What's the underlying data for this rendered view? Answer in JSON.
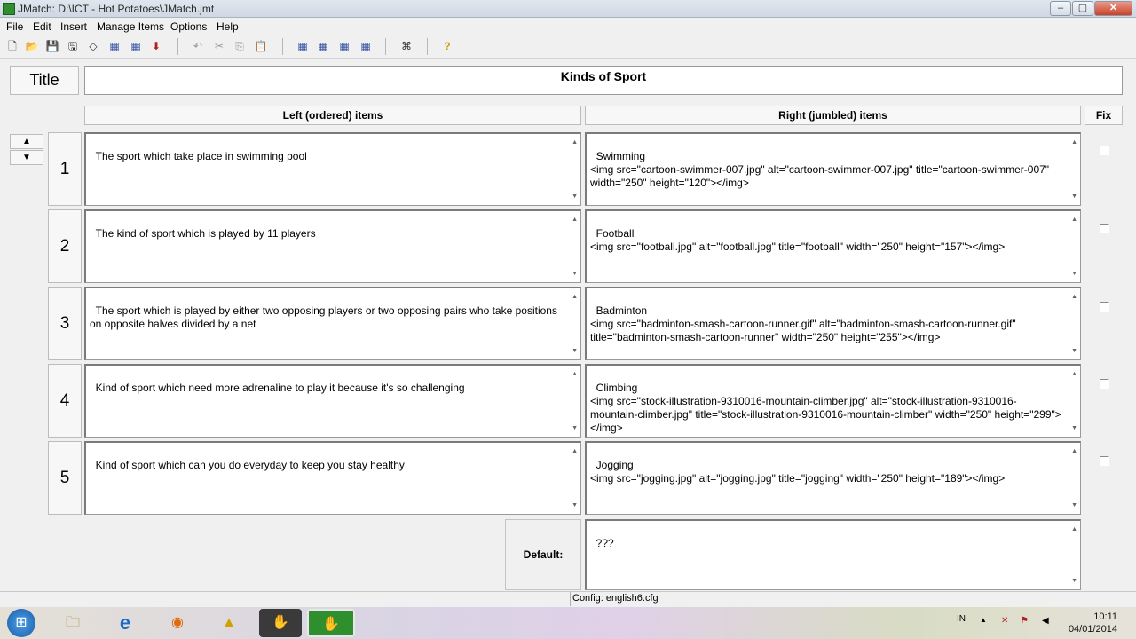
{
  "window": {
    "title": "JMatch: D:\\ICT - Hot Potatoes\\JMatch.jmt",
    "min": "‒",
    "max": "▢",
    "close": "✕"
  },
  "menu": [
    "File",
    "Edit",
    "Insert",
    "Manage Items",
    "Options",
    "Help"
  ],
  "toolbar": {
    "new": "🗋",
    "open": "📂",
    "save": "💾",
    "save_as": "🖫",
    "clear": "◇",
    "web1": "▦",
    "web2": "▦",
    "export": "⬇",
    "undo": "↶",
    "cut": "✂",
    "copy": "⎘",
    "paste": "📋",
    "config1": "▦",
    "config2": "▦",
    "config3": "▦",
    "config4": "▦",
    "dict": "⌘",
    "help": "?"
  },
  "title_label": "Title",
  "title_value": "Kinds of Sport",
  "headers": {
    "left": "Left (ordered) items",
    "right": "Right (jumbled) items",
    "fix": "Fix"
  },
  "arrows": {
    "up": "▲",
    "down": "▼"
  },
  "rows": [
    {
      "num": "1",
      "left": "The sport which take place in swimming pool",
      "right": "Swimming\n<img src=\"cartoon-swimmer-007.jpg\" alt=\"cartoon-swimmer-007.jpg\" title=\"cartoon-swimmer-007\" width=\"250\" height=\"120\"></img>"
    },
    {
      "num": "2",
      "left": "The kind of sport which is played by 11 players",
      "right": "Football\n<img src=\"football.jpg\" alt=\"football.jpg\" title=\"football\" width=\"250\" height=\"157\"></img>"
    },
    {
      "num": "3",
      "left": "The sport which is played by either two opposing players or two opposing pairs who take positions on opposite halves divided by a net",
      "right": "Badminton\n<img src=\"badminton-smash-cartoon-runner.gif\" alt=\"badminton-smash-cartoon-runner.gif\" title=\"badminton-smash-cartoon-runner\" width=\"250\" height=\"255\"></img>"
    },
    {
      "num": "4",
      "left": "Kind of sport which need more adrenaline to play it because it's so challenging",
      "right": "Climbing\n<img src=\"stock-illustration-9310016-mountain-climber.jpg\" alt=\"stock-illustration-9310016-mountain-climber.jpg\" title=\"stock-illustration-9310016-mountain-climber\" width=\"250\" height=\"299\"></img>"
    },
    {
      "num": "5",
      "left": "Kind of sport which can you do everyday to keep you stay healthy",
      "right": "Jogging\n<img src=\"jogging.jpg\" alt=\"jogging.jpg\" title=\"jogging\" width=\"250\" height=\"189\"></img>"
    }
  ],
  "default_label": "Default:",
  "default_value": "???",
  "status": {
    "config": "Config: english6.cfg"
  },
  "taskbar": {
    "start": "⊞",
    "explorer": "🗀",
    "ie": "e",
    "firefox": "◉",
    "hotpot": "▲",
    "app1": "✋",
    "app2": "✋",
    "lang": "IN",
    "time": "10:11",
    "date": "04/01/2014"
  },
  "colors": {
    "accent": "#2f8f2f",
    "close": "#c8432b"
  }
}
